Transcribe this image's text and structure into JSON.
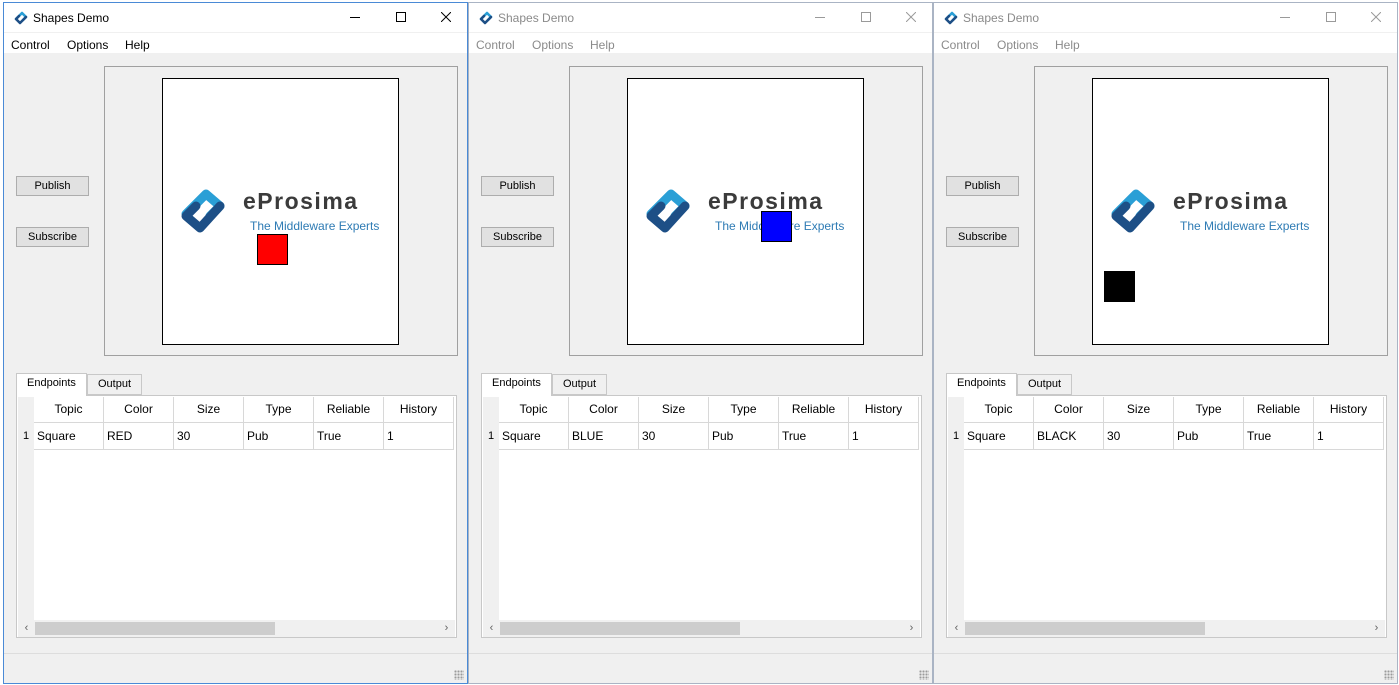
{
  "windows": [
    {
      "title": "Shapes Demo",
      "active": true,
      "menu": [
        "Control",
        "Options",
        "Help"
      ],
      "publish_label": "Publish",
      "subscribe_label": "Subscribe",
      "logo_brand": "eProsima",
      "logo_tagline": "The Middleware Experts",
      "shape": {
        "kind": "square",
        "color": "#ff0000"
      },
      "tabs": [
        "Endpoints",
        "Output"
      ],
      "selected_tab": "Endpoints",
      "table": {
        "columns": [
          "Topic",
          "Color",
          "Size",
          "Type",
          "Reliable",
          "History"
        ],
        "rows": [
          {
            "num": "1",
            "cells": [
              "Square",
              "RED",
              "30",
              "Pub",
              "True",
              "1"
            ]
          }
        ]
      },
      "scroll_left": "‹",
      "scroll_right": "›"
    },
    {
      "title": "Shapes Demo",
      "active": false,
      "menu": [
        "Control",
        "Options",
        "Help"
      ],
      "publish_label": "Publish",
      "subscribe_label": "Subscribe",
      "logo_brand": "eProsima",
      "logo_tagline": "The Middleware Experts",
      "shape": {
        "kind": "square",
        "color": "#0000ff"
      },
      "tabs": [
        "Endpoints",
        "Output"
      ],
      "selected_tab": "Endpoints",
      "table": {
        "columns": [
          "Topic",
          "Color",
          "Size",
          "Type",
          "Reliable",
          "History"
        ],
        "rows": [
          {
            "num": "1",
            "cells": [
              "Square",
              "BLUE",
              "30",
              "Pub",
              "True",
              "1"
            ]
          }
        ]
      },
      "scroll_left": "‹",
      "scroll_right": "›"
    },
    {
      "title": "Shapes Demo",
      "active": false,
      "menu": [
        "Control",
        "Options",
        "Help"
      ],
      "publish_label": "Publish",
      "subscribe_label": "Subscribe",
      "logo_brand": "eProsima",
      "logo_tagline": "The Middleware Experts",
      "shape": {
        "kind": "square",
        "color": "#000000"
      },
      "tabs": [
        "Endpoints",
        "Output"
      ],
      "selected_tab": "Endpoints",
      "table": {
        "columns": [
          "Topic",
          "Color",
          "Size",
          "Type",
          "Reliable",
          "History"
        ],
        "rows": [
          {
            "num": "1",
            "cells": [
              "Square",
              "BLACK",
              "30",
              "Pub",
              "True",
              "1"
            ]
          }
        ]
      },
      "scroll_left": "‹",
      "scroll_right": "›"
    }
  ]
}
